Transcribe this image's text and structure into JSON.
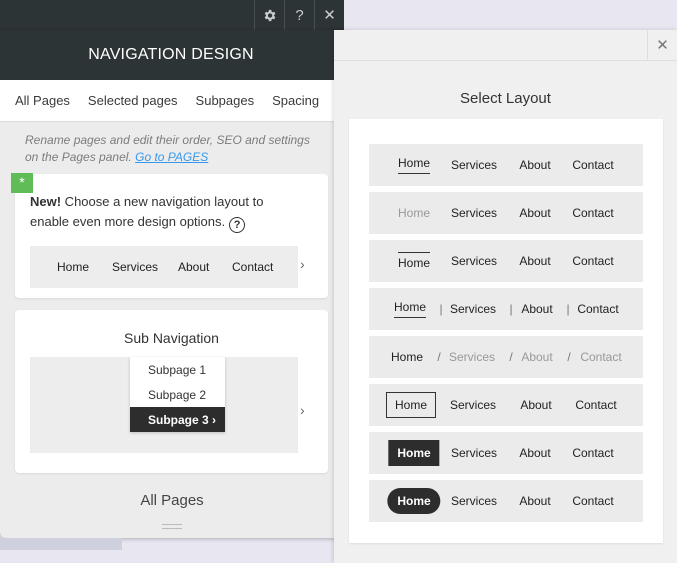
{
  "toolbar": {
    "settings_icon": "gear-icon",
    "help_label": "?",
    "close_label": "✕"
  },
  "panel": {
    "title": "NAVIGATION DESIGN",
    "tabs": [
      "All Pages",
      "Selected pages",
      "Subpages",
      "Spacing"
    ],
    "hint": "Rename pages and edit their order, SEO and settings on the Pages panel.",
    "hint_link": "Go to PAGES",
    "new_card": {
      "badge": "*",
      "bold": "New!",
      "text": " Choose a new navigation layout to enable even more design options.",
      "help": "?",
      "items": [
        "Home",
        "Services",
        "About",
        "Contact"
      ],
      "arrow": "›"
    },
    "sub_card": {
      "title": "Sub Navigation",
      "items": [
        "Subpage 1",
        "Subpage 2",
        "Subpage 3 ›"
      ],
      "arrow": "›"
    },
    "footer": "All Pages"
  },
  "layout_panel": {
    "close_label": "✕",
    "title": "Select Layout",
    "rows": [
      {
        "style": "underline-home",
        "items": [
          "Home",
          "Services",
          "About",
          "Contact"
        ]
      },
      {
        "style": "plain-gray",
        "items": [
          "Home",
          "Services",
          "About",
          "Contact"
        ]
      },
      {
        "style": "overline-home",
        "items": [
          "Home",
          "Services",
          "About",
          "Contact"
        ]
      },
      {
        "style": "pipe-separated",
        "items": [
          "Home",
          "|",
          "Services",
          "|",
          "About",
          "|",
          "Contact"
        ]
      },
      {
        "style": "slash-separated",
        "items": [
          "Home",
          "/",
          "Services",
          "/",
          "About",
          "/",
          "Contact"
        ]
      },
      {
        "style": "boxed-home",
        "items": [
          "Home",
          "Services",
          "About",
          "Contact"
        ]
      },
      {
        "style": "filled-home",
        "items": [
          "Home",
          "Services",
          "About",
          "Contact"
        ]
      },
      {
        "style": "pill-home",
        "items": [
          "Home",
          "Services",
          "About",
          "Contact"
        ]
      }
    ]
  },
  "colors": {
    "dark": "#2d3436",
    "accent_green": "#60bc57",
    "link": "#3899ec"
  }
}
